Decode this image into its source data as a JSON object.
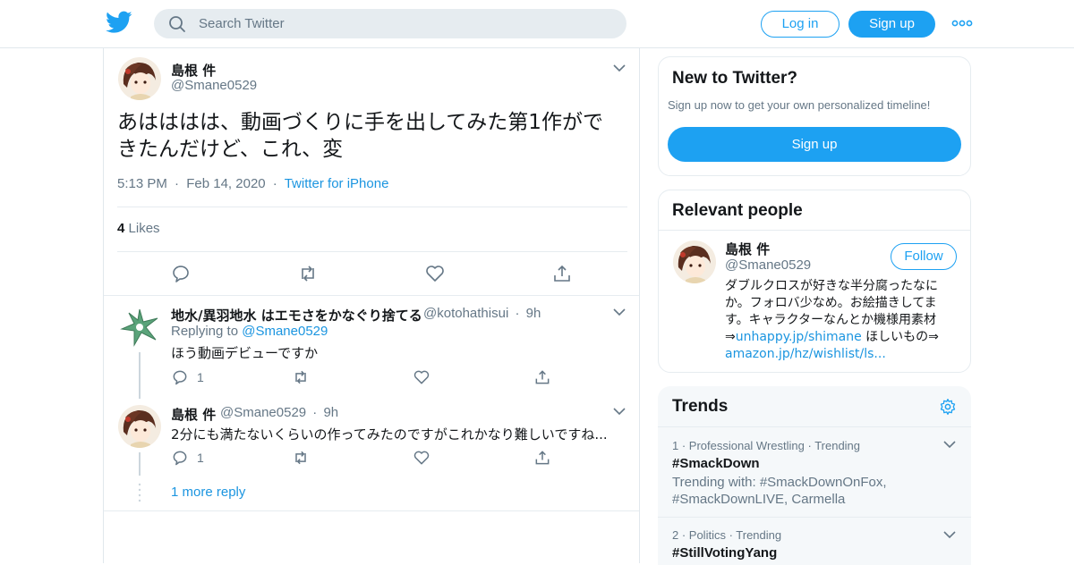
{
  "header": {
    "search_placeholder": "Search Twitter",
    "login_label": "Log in",
    "signup_label": "Sign up"
  },
  "tweet": {
    "name": "島根 件",
    "handle": "@Smane0529",
    "text_line1": "あはははは、動画づくりに手を出してみた第1作がで",
    "text_line2": "きたんだけど、これ、変",
    "time": "5:13 PM",
    "date": "Feb 14, 2020",
    "source": "Twitter for iPhone",
    "likes_count": "4",
    "likes_label": "Likes"
  },
  "replies": [
    {
      "name": "地水/異羽地水 はエモさをかなぐり捨てる",
      "handle": "@kotohathisui",
      "time": "9h",
      "replying_label": "Replying to",
      "replying_to": "@Smane0529",
      "text": "ほう動画デビューですか",
      "reply_count": "1"
    },
    {
      "name": "島根 件",
      "handle": "@Smane0529",
      "time": "9h",
      "text": "2分にも満たないくらいの作ってみたのですがこれかなり難しいですね...",
      "reply_count": "1"
    }
  ],
  "more_replies_label": "1 more reply",
  "new_to_twitter": {
    "title": "New to Twitter?",
    "subtitle": "Sign up now to get your own personalized timeline!",
    "button": "Sign up"
  },
  "relevant_people": {
    "title": "Relevant people",
    "name": "島根 件",
    "handle": "@Smane0529",
    "follow_label": "Follow",
    "bio_text": "ダブルクロスが好きな半分腐ったなにか。フォロバ少なめ。お絵描きしてます。キャラクターなんとか機様用素材⇒",
    "bio_link1": "unhappy.jp/shimane",
    "bio_mid": " ほしいもの⇒",
    "bio_link2": "amazon.jp/hz/wishlist/ls..."
  },
  "trends": {
    "title": "Trends",
    "items": [
      {
        "rank_meta": "1 · Professional Wrestling · Trending",
        "name": "#SmackDown",
        "with": "Trending with: #SmackDownOnFox, #SmackDownLIVE, Carmella"
      },
      {
        "rank_meta": "2 · Politics · Trending",
        "name": "#StillVotingYang"
      }
    ]
  },
  "colors": {
    "accent": "#1da1f2",
    "link": "#1b95e0",
    "secondary_text": "#657786",
    "border": "#e6ecf0"
  }
}
